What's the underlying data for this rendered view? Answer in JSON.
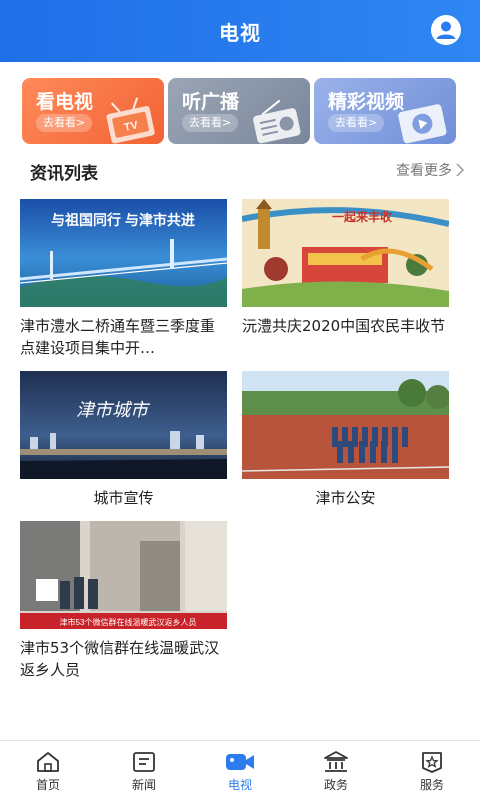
{
  "header": {
    "title": "电视",
    "user_icon": "user-avatar-icon"
  },
  "categories": [
    {
      "label": "看电视",
      "sub": "去看看>",
      "icon": "tv-icon",
      "color": "#f26234"
    },
    {
      "label": "听广播",
      "sub": "去看看>",
      "icon": "radio-icon",
      "color": "#7a869a"
    },
    {
      "label": "精彩视频",
      "sub": "去看看>",
      "icon": "video-play-icon",
      "color": "#6f8fd8"
    }
  ],
  "section": {
    "title": "资讯列表",
    "more": "查看更多"
  },
  "news": [
    {
      "caption": "津市澧水二桥通车暨三季度重点建设项目集中开…",
      "thumb_text": "与祖国同行  与津市共进"
    },
    {
      "caption": "沅澧共庆2020中国农民丰收节",
      "thumb_text": "一起来丰收"
    },
    {
      "caption": "城市宣传",
      "thumb_text": "津市城市"
    },
    {
      "caption": "津市公安",
      "thumb_text": ""
    },
    {
      "caption": "津市53个微信群在线温暖武汉返乡人员",
      "thumb_text": "津市53个微信群在线温暖武汉返乡人员"
    }
  ],
  "tabbar": [
    {
      "label": "首页",
      "icon": "home-icon",
      "active": false
    },
    {
      "label": "新闻",
      "icon": "news-icon",
      "active": false
    },
    {
      "label": "电视",
      "icon": "camera-icon",
      "active": true
    },
    {
      "label": "政务",
      "icon": "government-icon",
      "active": false
    },
    {
      "label": "服务",
      "icon": "service-star-icon",
      "active": false
    }
  ],
  "colors": {
    "accent": "#2a7cf0",
    "header": "#1f6fe8"
  }
}
